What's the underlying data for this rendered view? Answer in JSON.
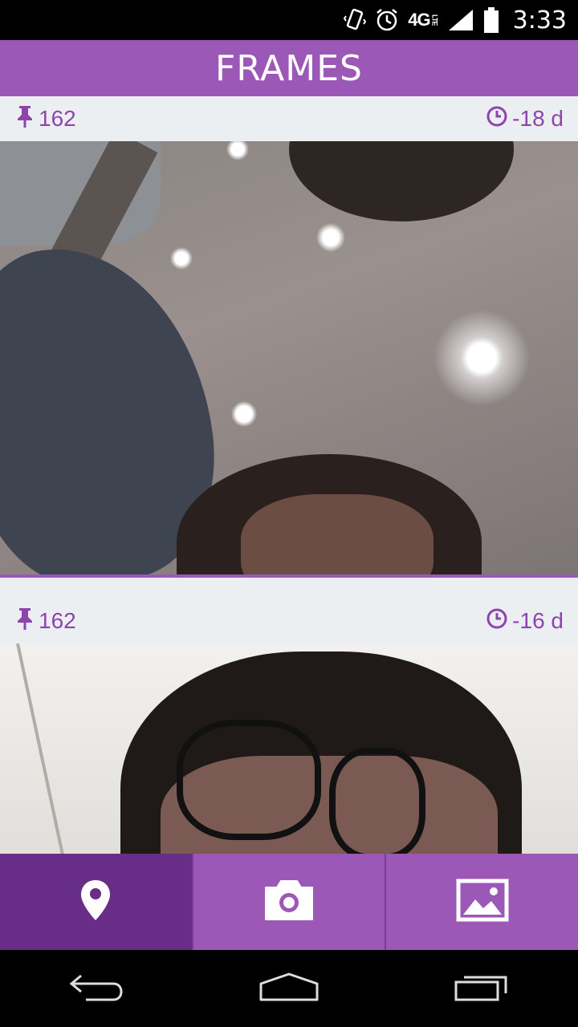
{
  "status_bar": {
    "time": "3:33",
    "network": "4G",
    "network_sub": "LTE",
    "icons": [
      "vibrate-icon",
      "alarm-icon",
      "signal-icon",
      "battery-icon"
    ]
  },
  "app_bar": {
    "title": "FRAMES"
  },
  "feed": {
    "cards": [
      {
        "pin_count": "162",
        "age": "-18 d",
        "photo": "selfie-ceiling-lights"
      },
      {
        "pin_count": "162",
        "age": "-16 d",
        "photo": "selfie-glasses"
      }
    ]
  },
  "bottom_nav": {
    "items": [
      {
        "icon": "location-pin-icon",
        "active": true
      },
      {
        "icon": "camera-icon",
        "active": false
      },
      {
        "icon": "gallery-icon",
        "active": false
      }
    ]
  },
  "system_nav": {
    "icons": [
      "back-icon",
      "home-icon",
      "recents-icon"
    ]
  },
  "colors": {
    "accent": "#9b58b6",
    "accent_dark": "#682d86",
    "meta_text": "#8e44ad",
    "card_bg": "#eceff1"
  }
}
